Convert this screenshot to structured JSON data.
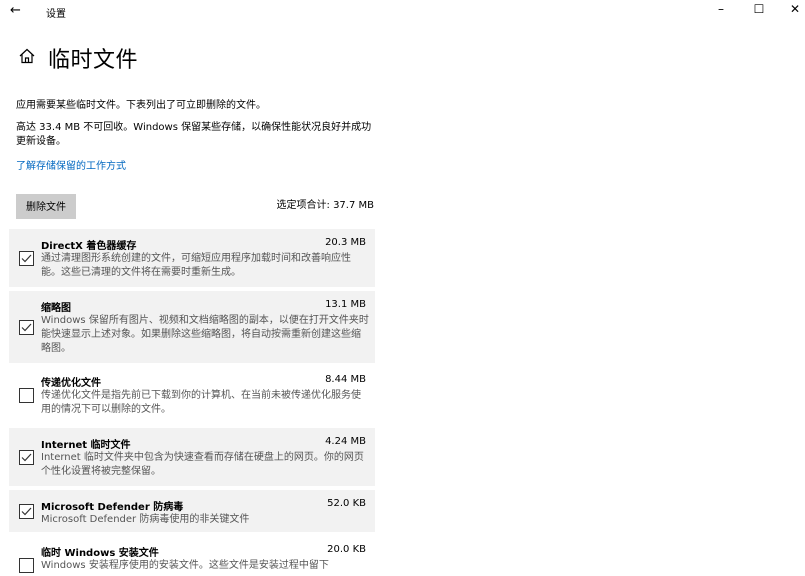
{
  "window": {
    "back_icon": "←",
    "title": "设置",
    "minimize_icon": "–",
    "maximize_icon": "☐",
    "close_icon": "✕"
  },
  "page": {
    "home_icon": "home-icon",
    "title": "临时文件",
    "description": "应用需要某些临时文件。下表列出了可立即删除的文件。",
    "reserved_note": "高达 33.4 MB 不可回收。Windows 保留某些存储，以确保性能状况良好并成功更新设备。",
    "learn_link": "了解存储保留的工作方式"
  },
  "actions": {
    "delete_label": "删除文件",
    "selected_total": "选定项合计: 37.7 MB"
  },
  "colors": {
    "link": "#0067c0",
    "selected_background": "#f2f2f2",
    "button_background": "#cccccc"
  },
  "items": [
    {
      "name": "DirectX 着色器缓存",
      "size": "20.3 MB",
      "description": "通过清理图形系统创建的文件，可缩短应用程序加载时间和改善响应性能。这些已清理的文件将在需要时重新生成。",
      "checked": true
    },
    {
      "name": "缩略图",
      "size": "13.1 MB",
      "description": "Windows 保留所有图片、视频和文档缩略图的副本，以便在打开文件夹时能快速显示上述对象。如果删除这些缩略图，将自动按需重新创建这些缩略图。",
      "checked": true
    },
    {
      "name": "传递优化文件",
      "size": "8.44 MB",
      "description": "传递优化文件是指先前已下载到你的计算机、在当前未被传递优化服务使用的情况下可以删除的文件。",
      "checked": false
    },
    {
      "name": "Internet 临时文件",
      "size": "4.24 MB",
      "description": "Internet 临时文件夹中包含为快速查看而存储在硬盘上的网页。你的网页个性化设置将被完整保留。",
      "checked": true
    },
    {
      "name": "Microsoft Defender 防病毒",
      "size": "52.0 KB",
      "description": "Microsoft Defender 防病毒使用的非关键文件",
      "checked": true
    },
    {
      "name": "临时 Windows 安装文件",
      "size": "20.0 KB",
      "description": "Windows 安装程序使用的安装文件。这些文件是安装过程中留下",
      "checked": false
    }
  ]
}
